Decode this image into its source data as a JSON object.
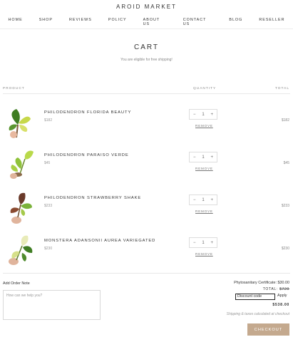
{
  "brand": "AROID MARKET",
  "nav": [
    "HOME",
    "SHOP",
    "REVIEWS",
    "POLICY",
    "ABOUT US",
    "CONTACT US",
    "BLOG",
    "RESELLER"
  ],
  "cart": {
    "title": "CART",
    "shipping_message": "You are eligible for free shipping!",
    "headers": {
      "product": "PRODUCT",
      "quantity": "QUANTITY",
      "total": "TOTAL"
    },
    "items": [
      {
        "name": "PHILODENDRON FLORIDA BEAUTY",
        "price": "$182",
        "qty": "1",
        "total": "$182",
        "remove": "REMOVE"
      },
      {
        "name": "PHILODENDRON PARAISO VERDE",
        "price": "$45",
        "qty": "1",
        "total": "$45",
        "remove": "REMOVE"
      },
      {
        "name": "PHILODENDRON STRAWBERRY SHAKE",
        "price": "$233",
        "qty": "1",
        "total": "$233",
        "remove": "REMOVE"
      },
      {
        "name": "MONSTERA ADANSONII AUREA VARIEGATED",
        "price": "$230",
        "qty": "1",
        "total": "$230",
        "remove": "REMOVE"
      }
    ],
    "qty_minus": "−",
    "qty_plus": "+"
  },
  "footer": {
    "order_note_label": "Add Order Note",
    "order_note_placeholder": "How can we help you?",
    "phytosanitary": "Phytosanitary Certificate: $30.00",
    "total_label": "TOTAL:",
    "total_struck": "$720",
    "discount_value": "Discount code",
    "apply_label": "Apply",
    "grand_total": "$538.00",
    "shipping_note": "Shipping & taxes calculated at checkout",
    "checkout_label": "CHECKOUT"
  },
  "colors": {
    "checkout_bg": "#c4a98e",
    "leaf_green": "#4f8a2c"
  }
}
